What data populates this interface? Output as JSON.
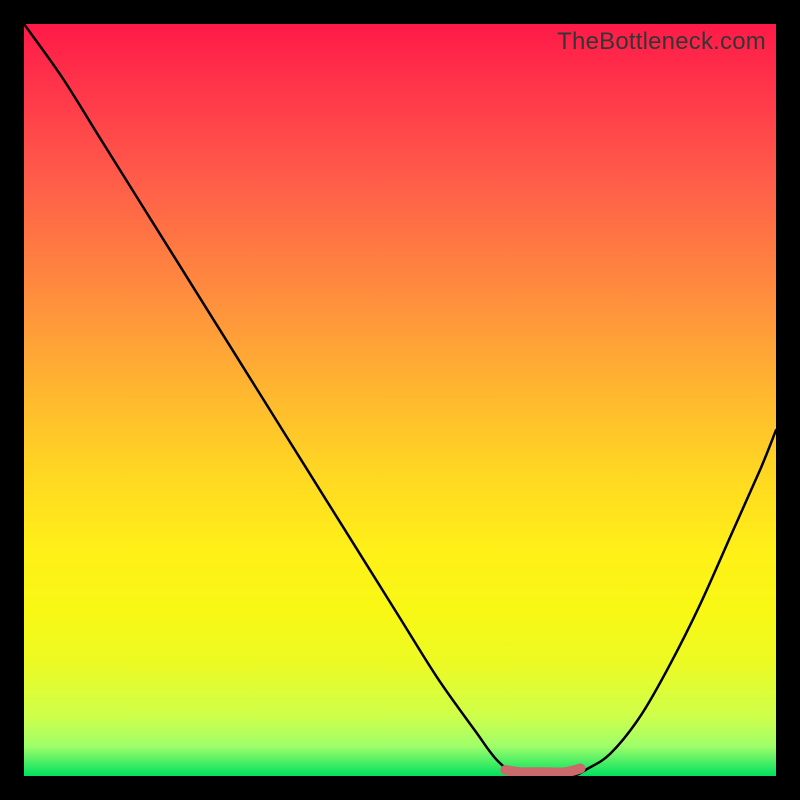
{
  "attribution": "TheBottleneck.com",
  "chart_data": {
    "type": "line",
    "title": "",
    "xlabel": "",
    "ylabel": "",
    "xlim": [
      0,
      1
    ],
    "ylim": [
      0,
      1
    ],
    "series": [
      {
        "name": "curve",
        "x": [
          0.0,
          0.05,
          0.1,
          0.15,
          0.2,
          0.25,
          0.3,
          0.35,
          0.4,
          0.45,
          0.5,
          0.55,
          0.6,
          0.63,
          0.66,
          0.7,
          0.73,
          0.75,
          0.78,
          0.82,
          0.86,
          0.9,
          0.94,
          0.98,
          1.0
        ],
        "values": [
          1.0,
          0.93,
          0.85,
          0.77,
          0.69,
          0.61,
          0.53,
          0.45,
          0.37,
          0.29,
          0.21,
          0.13,
          0.06,
          0.02,
          0.0,
          0.0,
          0.0,
          0.01,
          0.03,
          0.08,
          0.15,
          0.23,
          0.32,
          0.41,
          0.46
        ]
      },
      {
        "name": "bottom-marker",
        "x": [
          0.64,
          0.66,
          0.69,
          0.72,
          0.74
        ],
        "values": [
          0.008,
          0.005,
          0.005,
          0.005,
          0.01
        ]
      }
    ],
    "colors": {
      "curve": "#000000",
      "bottom_marker": "#ca6a6a",
      "gradient_top": "#ff1a48",
      "gradient_bottom": "#00e060"
    }
  }
}
